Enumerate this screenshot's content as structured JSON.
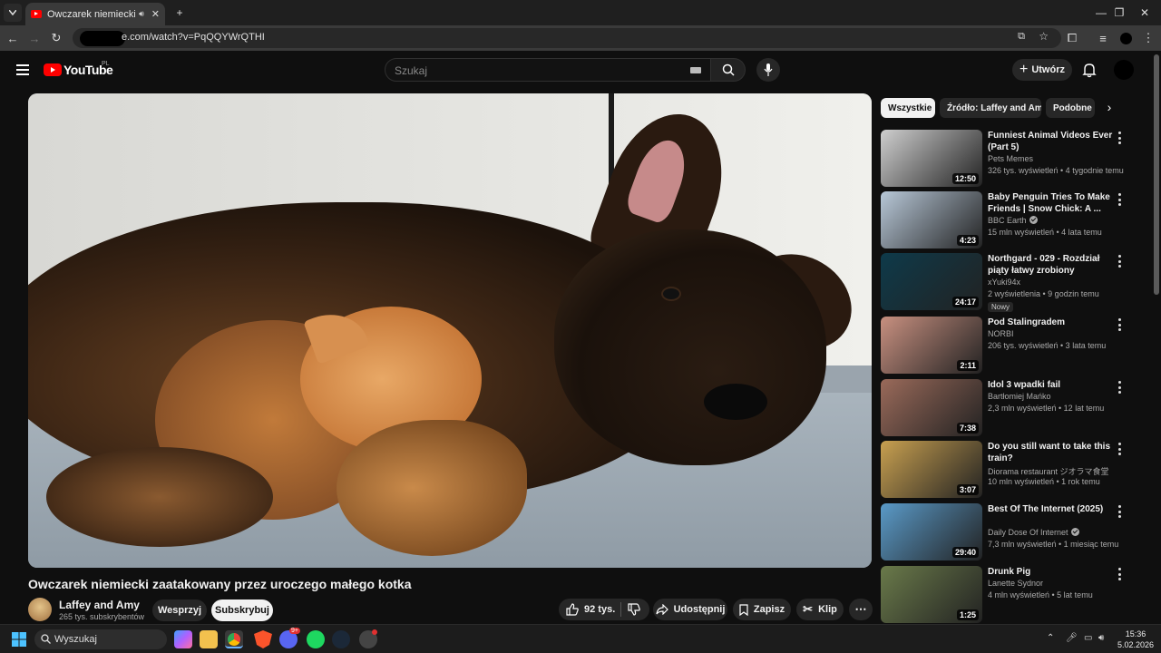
{
  "browser": {
    "tab_title": "Owczarek niemiecki zaatakowany przez uroczego małego kotka",
    "url": "e.com/watch?v=PqQQYWrQTHI",
    "new_tab": "+"
  },
  "youtube": {
    "logo": "YouTube",
    "region": "PL",
    "search_placeholder": "Szukaj",
    "create_label": "Utwórz"
  },
  "video": {
    "title": "Owczarek niemiecki zaatakowany przez uroczego małego kotka",
    "channel": "Laffey and Amy",
    "subscribers": "265 tys. subskrybentów",
    "support_label": "Wesprzyj",
    "subscribe_label": "Subskrybuj",
    "likes": "92 tys.",
    "share_label": "Udostępnij",
    "save_label": "Zapisz",
    "clip_label": "Klip"
  },
  "chips": [
    "Wszystkie",
    "Źródło: Laffey and Amy",
    "Podobne"
  ],
  "recommendations": [
    {
      "title": "Funniest Animal Videos Ever (Part 5)",
      "channel": "Pets Memes",
      "meta": "326 tys. wyświetleń • 4 tygodnie temu",
      "duration": "12:50",
      "verified": false,
      "thumb_color": "#cfcfcf"
    },
    {
      "title": "Baby Penguin Tries To Make Friends | Snow Chick: A ...",
      "channel": "BBC Earth",
      "meta": "15 mln wyświetleń • 4 lata temu",
      "duration": "4:23",
      "verified": true,
      "thumb_color": "#b8c8d8"
    },
    {
      "title": "Northgard - 029 - Rozdział piąty łatwy zrobiony",
      "channel": "xYuki94x",
      "meta": "2 wyświetlenia • 9 godzin temu",
      "duration": "24:17",
      "verified": false,
      "badge": "Nowy",
      "thumb_color": "#0e3a4a"
    },
    {
      "title": "Pod Stalingradem",
      "channel": "NORBI",
      "meta": "206 tys. wyświetleń • 3 lata temu",
      "duration": "2:11",
      "verified": false,
      "thumb_color": "#c89080"
    },
    {
      "title": "Idol 3 wpadki fail",
      "channel": "Bartłomiej Mańko",
      "meta": "2,3 mln wyświetleń • 12 lat temu",
      "duration": "7:38",
      "verified": false,
      "thumb_color": "#9a6a5a"
    },
    {
      "title": "Do you still want to take this train?",
      "channel": "Diorama restaurant ジオラマ食堂",
      "meta": "10 mln wyświetleń • 1 rok temu",
      "duration": "3:07",
      "verified": false,
      "thumb_color": "#c8a050"
    },
    {
      "title": "Best Of The Internet (2025)",
      "channel": "Daily Dose Of Internet",
      "meta": "7,3 mln wyświetleń • 1 miesiąc temu",
      "duration": "29:40",
      "verified": true,
      "thumb_color": "#5a9ac8"
    },
    {
      "title": "Drunk Pig",
      "channel": "Lanette Sydnor",
      "meta": "4 mln wyświetleń • 5 lat temu",
      "duration": "1:25",
      "verified": false,
      "thumb_color": "#6a7a4a"
    }
  ],
  "taskbar": {
    "search_label": "Wyszukaj",
    "time": "15:36",
    "date": "5.02.2026",
    "discord_badge": "9+"
  }
}
